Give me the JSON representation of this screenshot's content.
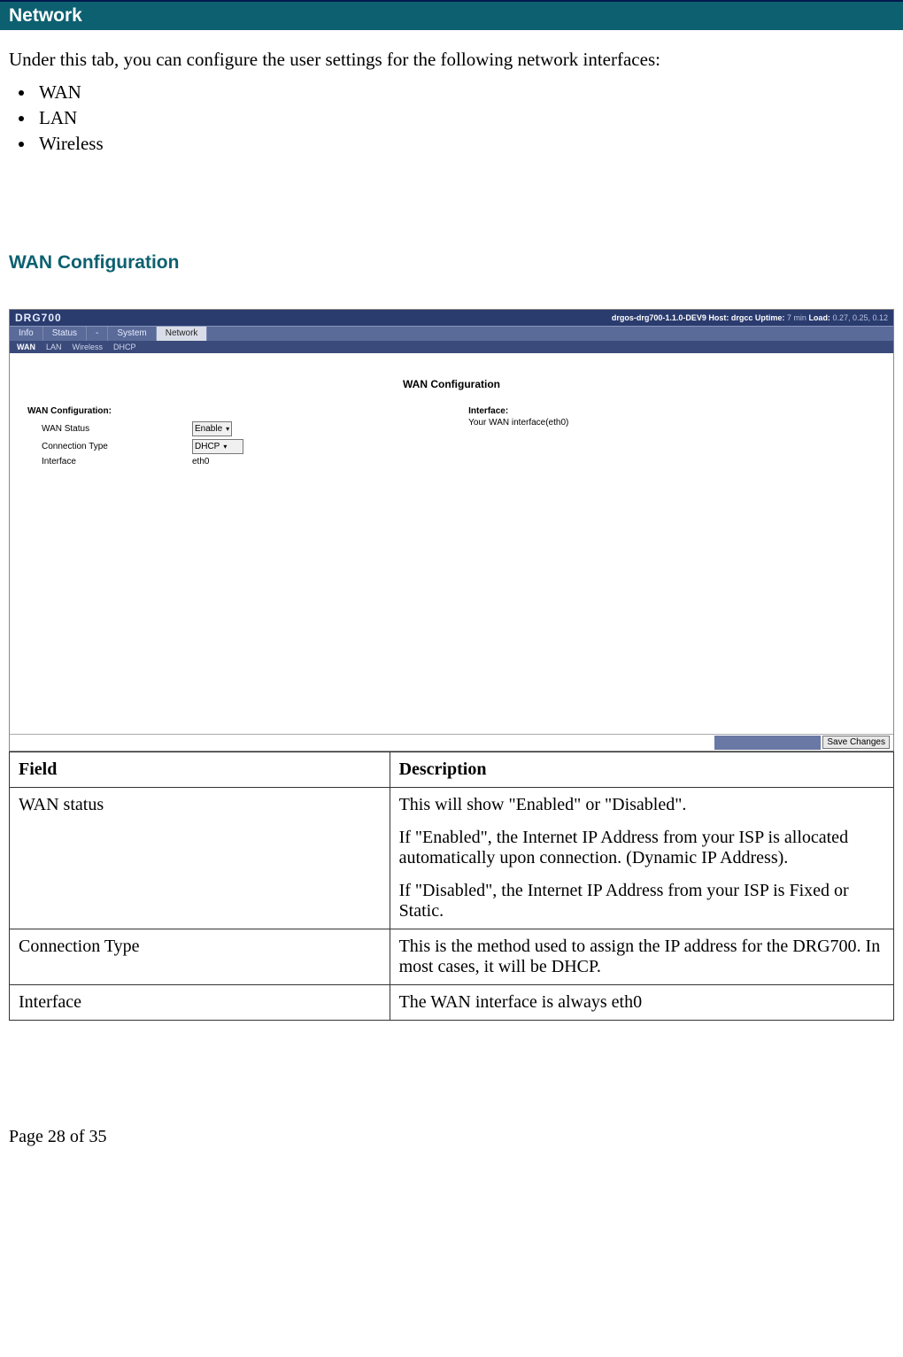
{
  "banner": {
    "title": "Network"
  },
  "intro": "Under this tab, you can configure the user settings for the following network interfaces:",
  "interfaces": [
    "WAN",
    "LAN",
    "Wireless"
  ],
  "section": {
    "title": "WAN Configuration"
  },
  "screenshot": {
    "brand": "DRG700",
    "status_line_prefix": "drgos-drg700-1.1.0-DEV9 Host: drgcc Uptime:",
    "status_line_uptime": " 7 min ",
    "status_line_load_label": "Load:",
    "status_line_load": " 0.27, 0.25, 0.12",
    "mainnav": [
      "Info",
      "Status",
      "-",
      "System",
      "Network"
    ],
    "mainnav_active": "Network",
    "subnav": [
      "WAN",
      "LAN",
      "Wireless",
      "DHCP"
    ],
    "subnav_active": "WAN",
    "page_title": "WAN Configuration",
    "left_heading": "WAN Configuration:",
    "rows": {
      "status_label": "WAN Status",
      "status_value": "Enable",
      "conn_label": "Connection Type",
      "conn_value": "DHCP",
      "iface_label": "Interface",
      "iface_value": "eth0"
    },
    "right_heading": "Interface:",
    "right_text": "Your WAN interface(eth0)",
    "save_button": "Save Changes"
  },
  "table": {
    "head_field": "Field",
    "head_desc": "Description",
    "rows": [
      {
        "field": "WAN status",
        "desc": [
          "This will show \"Enabled\" or \"Disabled\".",
          "If \"Enabled\", the Internet IP Address from your ISP is allocated automatically upon connection. (Dynamic IP Address).",
          "If \"Disabled\", the Internet IP Address from your ISP is Fixed or Static."
        ]
      },
      {
        "field": "Connection Type",
        "desc": [
          "This is the method used to assign the IP address for the DRG700. In most cases, it will be DHCP."
        ]
      },
      {
        "field": "Interface",
        "desc": [
          "The WAN interface is always eth0"
        ]
      }
    ]
  },
  "footer": "Page 28 of 35"
}
